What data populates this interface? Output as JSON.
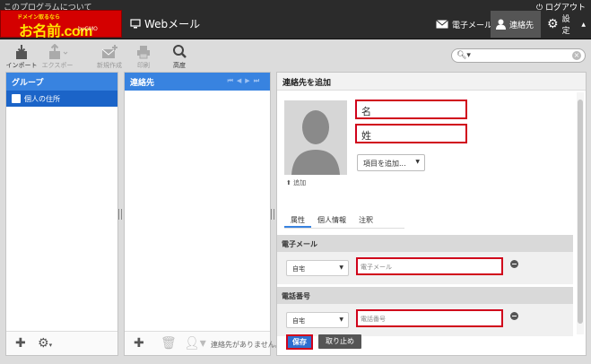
{
  "header": {
    "about_link": "このプログラムについて",
    "logout": "ログアウト",
    "logo": {
      "tagline": "ドメイン取るなら",
      "name": "お名前.com",
      "sub": "byGMO"
    },
    "app_title": "Webメール",
    "nav": {
      "mail": "電子メール",
      "contacts": "連絡先",
      "settings": "設定"
    }
  },
  "toolbar": {
    "import": "インポート",
    "export": "エクスポート",
    "compose": "新規作成",
    "print": "印刷",
    "advanced": "高度"
  },
  "groups": {
    "title": "グループ",
    "items": [
      {
        "label": "個人の住所"
      }
    ]
  },
  "contacts": {
    "title": "連絡先",
    "empty": "連絡先がありません。"
  },
  "detail": {
    "title": "連絡先を追加",
    "first_name_placeholder": "名",
    "last_name_placeholder": "姓",
    "photo_add": "追加",
    "add_field": "項目を追加...",
    "tabs": [
      "属性",
      "個人情報",
      "注釈"
    ],
    "email": {
      "heading": "電子メール",
      "type": "自宅",
      "placeholder": "電子メール"
    },
    "phone": {
      "heading": "電話番号",
      "type": "自宅",
      "placeholder": "電話番号"
    },
    "save": "保存",
    "cancel": "取り止め"
  },
  "colors": {
    "accent": "#3883e0",
    "highlight": "#d0021b",
    "topbar": "#2b2b2b"
  }
}
